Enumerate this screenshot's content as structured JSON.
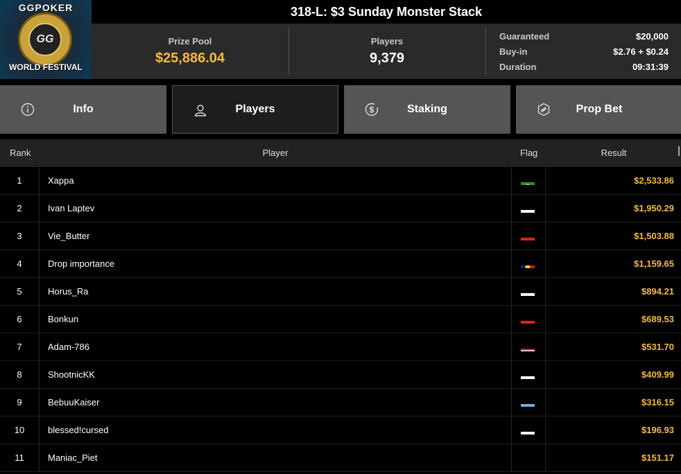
{
  "logo": {
    "top_text": "GGPOKER",
    "bottom_text": "WORLD FESTIVAL",
    "mark": "GG"
  },
  "tournament": {
    "title": "318-L: $3 Sunday Monster Stack"
  },
  "stats": {
    "prize_pool_label": "Prize Pool",
    "prize_pool_value": "$25,886.04",
    "players_label": "Players",
    "players_value": "9,379",
    "details": [
      {
        "key": "Guaranteed",
        "value": "$20,000"
      },
      {
        "key": "Buy-in",
        "value": "$2.76 + $0.24"
      },
      {
        "key": "Duration",
        "value": "09:31:39"
      }
    ]
  },
  "tabs": [
    {
      "label": "Info",
      "icon": "info-icon",
      "active": false
    },
    {
      "label": "Players",
      "icon": "user-icon",
      "active": true
    },
    {
      "label": "Staking",
      "icon": "dollar-coin-icon",
      "active": false
    },
    {
      "label": "Prop Bet",
      "icon": "prop-bet-icon",
      "active": false
    }
  ],
  "table": {
    "headers": {
      "rank": "Rank",
      "player": "Player",
      "flag": "Flag",
      "result": "Result"
    },
    "rows": [
      {
        "rank": "1",
        "player": "Xappa",
        "flag": "brazil-flag-icon",
        "result": "$2,533.86"
      },
      {
        "rank": "2",
        "player": "Ivan Laptev",
        "flag": "russia-flag-icon",
        "result": "$1,950.29"
      },
      {
        "rank": "3",
        "player": "Vie_Butter",
        "flag": "vietnam-flag-icon",
        "result": "$1,503.88"
      },
      {
        "rank": "4",
        "player": "Drop importance",
        "flag": "romania-flag-icon",
        "result": "$1,159.65"
      },
      {
        "rank": "5",
        "player": "Horus_Ra",
        "flag": "russia-flag-icon",
        "result": "$894.21"
      },
      {
        "rank": "6",
        "player": "Bonkun",
        "flag": "vietnam-flag-icon",
        "result": "$689.53"
      },
      {
        "rank": "7",
        "player": "Adam-786",
        "flag": "thailand-flag-icon",
        "result": "$531.70"
      },
      {
        "rank": "8",
        "player": "ShootnicKK",
        "flag": "russia-flag-icon",
        "result": "$409.99"
      },
      {
        "rank": "9",
        "player": "BebuuKaiser",
        "flag": "argentina-flag-icon",
        "result": "$316.15"
      },
      {
        "rank": "10",
        "player": "blessed!cursed",
        "flag": "russia-flag-icon",
        "result": "$196.93"
      },
      {
        "rank": "11",
        "player": "Maniac_Piet",
        "flag": "germany-flag-icon",
        "result": "$151.17"
      }
    ]
  },
  "colors": {
    "accent": "#f5b942",
    "tab_inactive": "#555555",
    "stats_bg": "#2a2a2a"
  }
}
